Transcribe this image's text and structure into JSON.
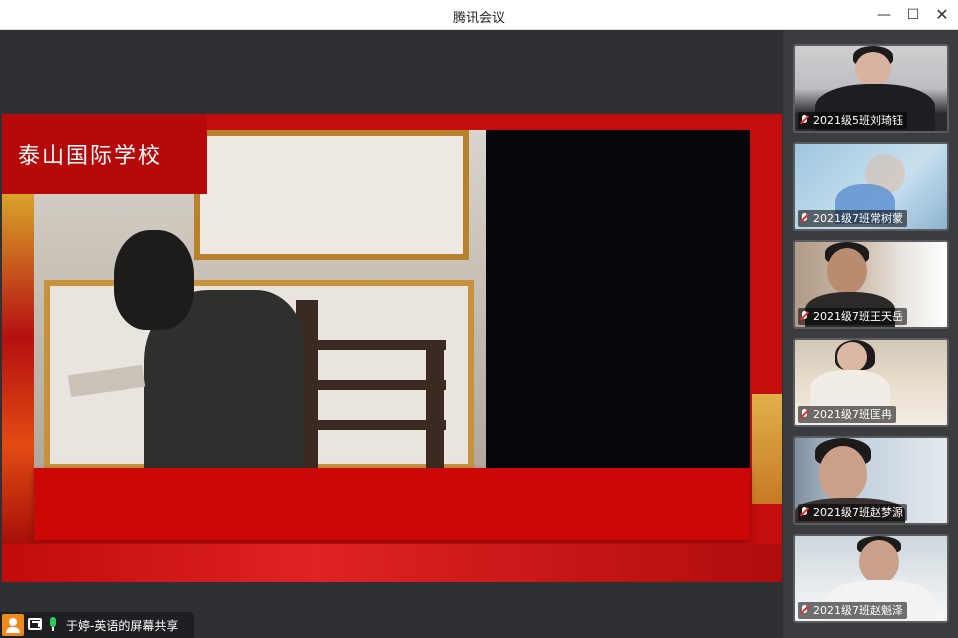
{
  "window": {
    "title": "腾讯会议",
    "minimize_glyph": "—",
    "maximize_glyph": "☐",
    "close_glyph": "✕"
  },
  "shared_screen": {
    "banner_text": "泰山国际学校"
  },
  "participants": [
    {
      "name": "2021级5班刘琦钰",
      "muted": true
    },
    {
      "name": "2021级7班常树蒙",
      "muted": true
    },
    {
      "name": "2021级7班王天岳",
      "muted": true
    },
    {
      "name": "2021级7班匡冉",
      "muted": true
    },
    {
      "name": "2021级7班赵梦源",
      "muted": true
    },
    {
      "name": "2021级7班赵魁泽",
      "muted": true
    }
  ],
  "status_bar": {
    "sharing_text": "于婷-英语的屏幕共享"
  },
  "colors": {
    "accent_orange": "#f08a1c",
    "mic_active": "#2ecc5a",
    "mic_muted": "#e03030",
    "stage_red": "#c40d0d"
  },
  "icons": [
    "minimize-icon",
    "maximize-icon",
    "close-icon",
    "user-icon",
    "screen-share-icon",
    "microphone-icon",
    "microphone-muted-icon"
  ]
}
